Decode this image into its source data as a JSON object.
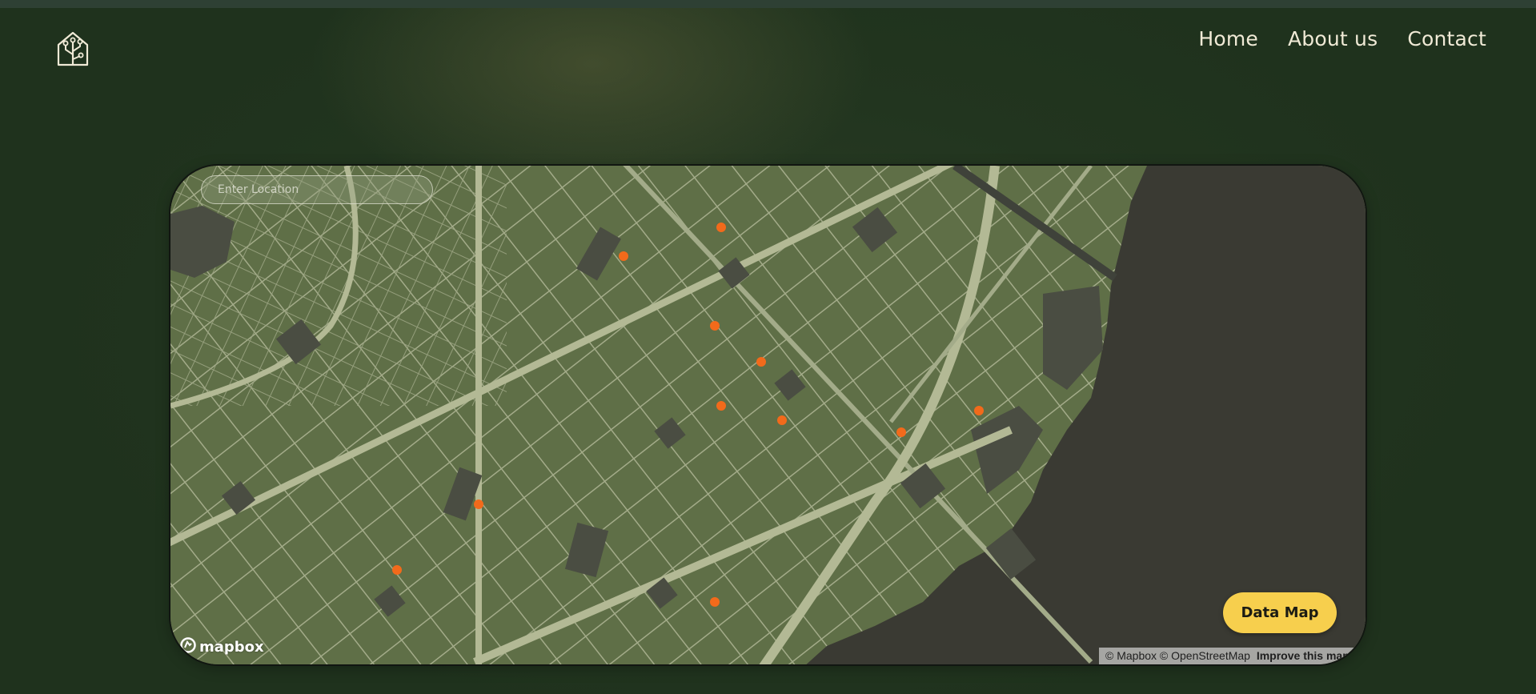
{
  "nav": {
    "logo_icon": "house-tree-logo-icon",
    "items": [
      "Home",
      "About us",
      "Contact"
    ]
  },
  "map": {
    "search_placeholder": "Enter Location",
    "data_button_label": "Data Map",
    "provider_logo_text": "mapbox",
    "attribution": {
      "mapbox": "© Mapbox",
      "osm": "© OpenStreetMap",
      "improve": "Improve this map"
    },
    "colors": {
      "land": "#5f6f47",
      "water": "#3a3a33",
      "roads": "#a3ab89",
      "buildings": "#4a4d42",
      "marker": "#f26a1b"
    },
    "marker_count": 12
  }
}
